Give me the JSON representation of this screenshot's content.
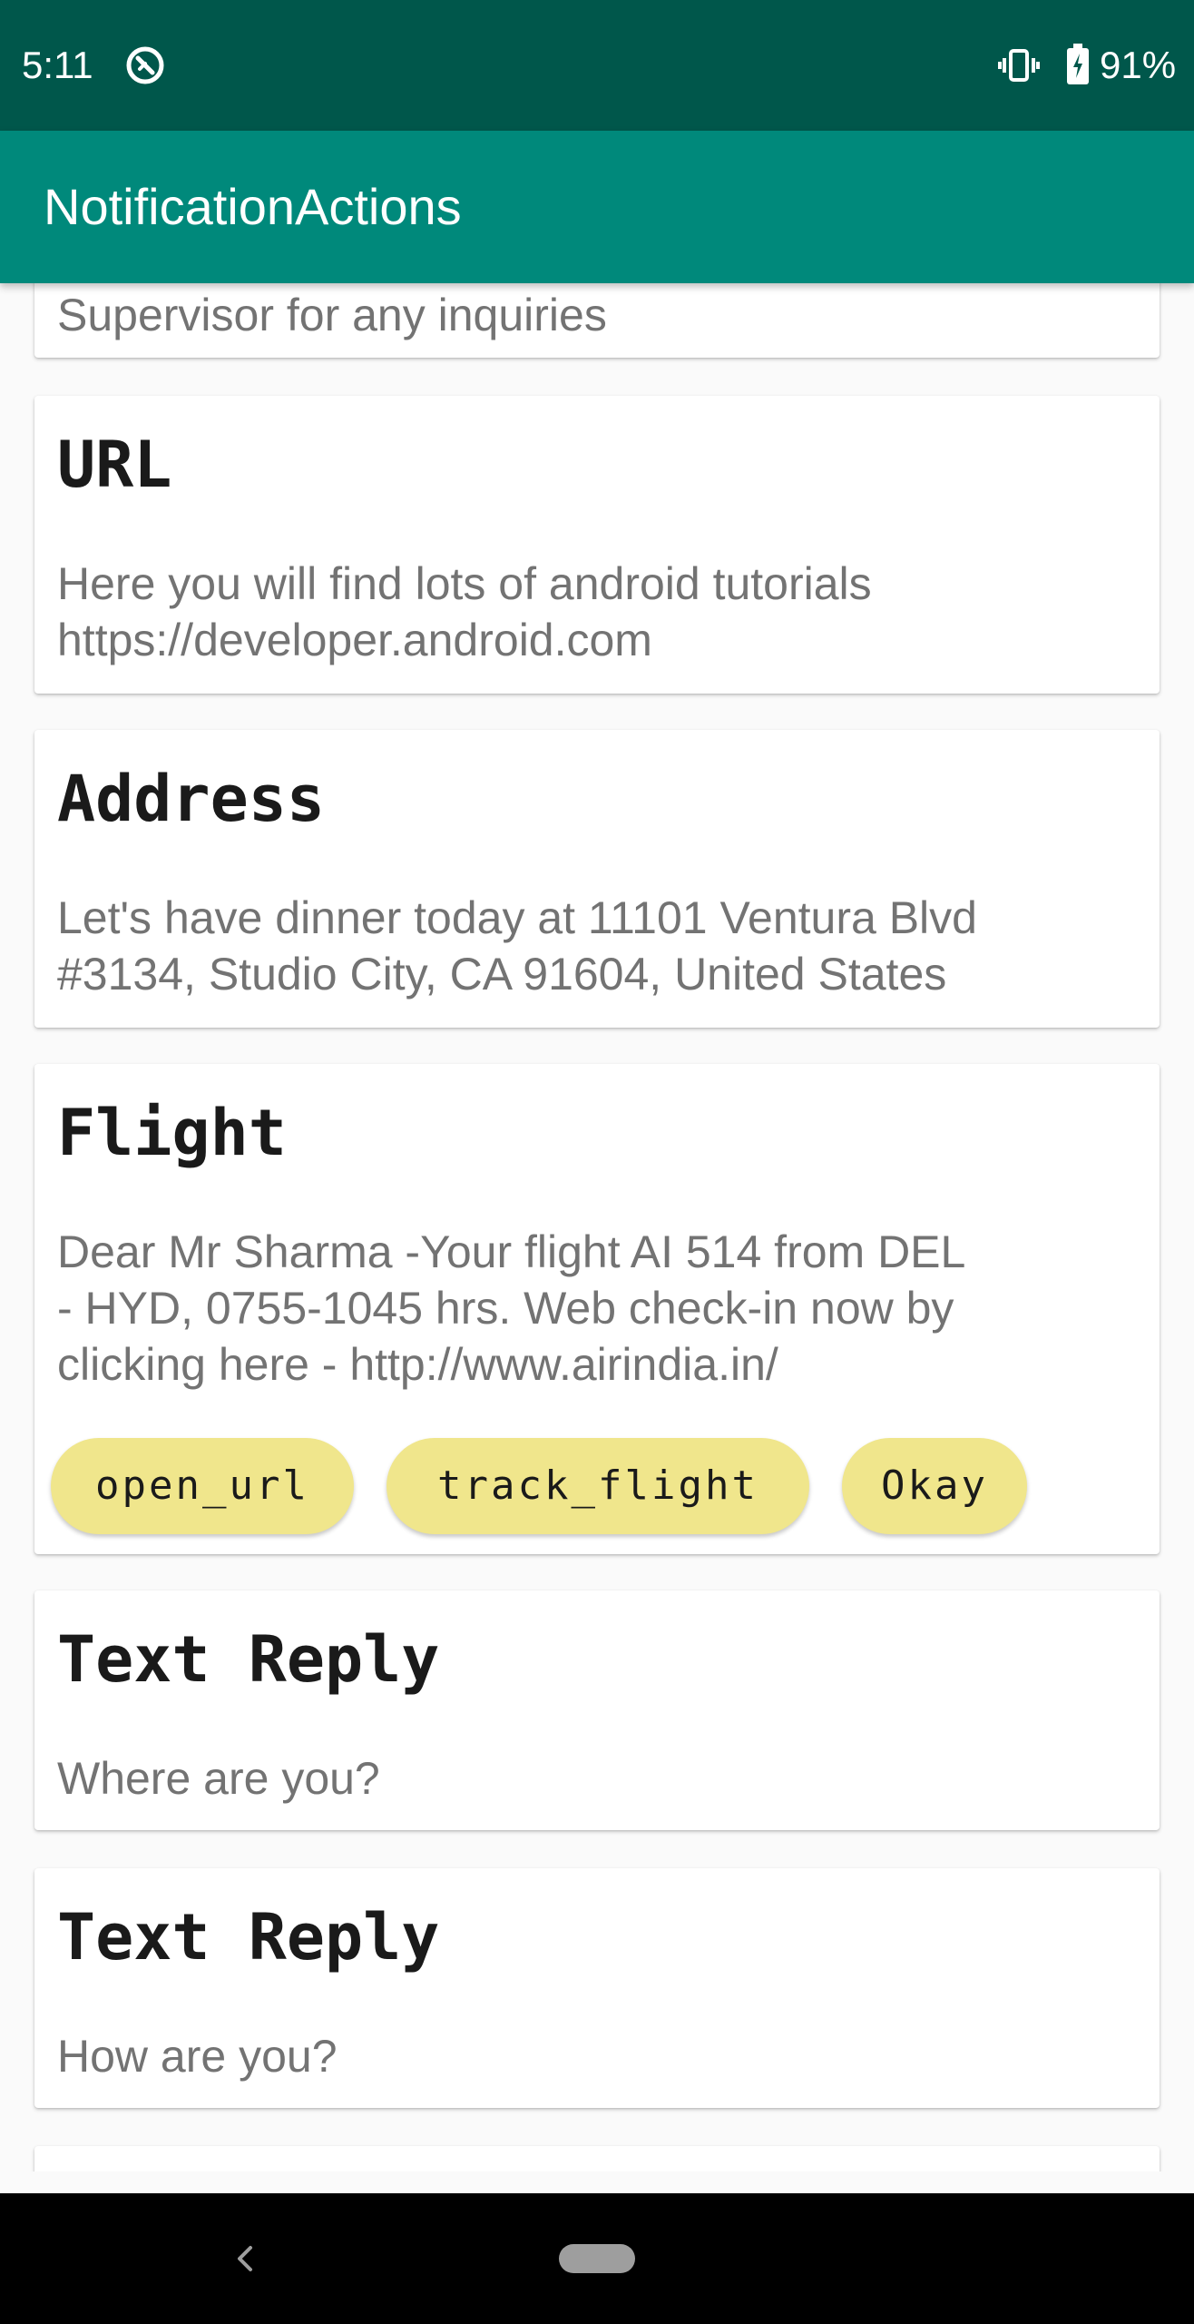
{
  "status_bar": {
    "time": "5:11",
    "battery": "91%",
    "background": "#00574b"
  },
  "app_bar": {
    "title": "NotificationActions",
    "background": "#00897b"
  },
  "cards": [
    {
      "title": "",
      "body": "Supervisor for any inquiries"
    },
    {
      "title": "URL",
      "body": "Here you will find lots of android tutorials\nhttps://developer.android.com"
    },
    {
      "title": "Address",
      "body": "Let's have dinner today at 11101 Ventura Blvd\n#3134, Studio City, CA 91604, United States"
    },
    {
      "title": "Flight",
      "body": "Dear Mr Sharma -Your flight AI 514 from DEL\n- HYD, 0755-1045 hrs. Web check-in now by\nclicking here - http://www.airindia.in/",
      "actions": [
        "open_url",
        "track_flight",
        "Okay"
      ]
    },
    {
      "title": "Text Reply",
      "body": "Where are you?"
    },
    {
      "title": "Text Reply",
      "body": "How are you?"
    }
  ],
  "colors": {
    "chip": "#f0e68c",
    "card_body_text": "#737373"
  },
  "icons": {
    "status_app": "app-notification-icon",
    "vibrate": "vibrate-icon",
    "battery": "battery-charging-icon",
    "nav_back": "back-icon",
    "nav_home": "home-pill-icon"
  }
}
